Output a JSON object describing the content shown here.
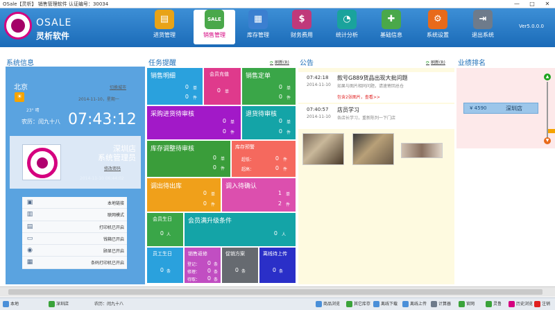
{
  "titlebar": {
    "text": "OSale【灵析】 销售管理软件 认证编号：30034",
    "min": "—",
    "max": "□",
    "close": "✕"
  },
  "brand": {
    "en": "OSALE",
    "cn": "灵析软件"
  },
  "nav": [
    {
      "label": "进货管理",
      "color": "#e8a317",
      "glyph": "▤"
    },
    {
      "label": "销售管理",
      "color": "#4aa84a",
      "glyph": "SALE"
    },
    {
      "label": "库存管理",
      "color": "#3b7fd0",
      "glyph": "▦"
    },
    {
      "label": "财务费用",
      "color": "#c0397a",
      "glyph": "$"
    },
    {
      "label": "统计分析",
      "color": "#1aa39c",
      "glyph": "◔"
    },
    {
      "label": "基础信息",
      "color": "#4aa84a",
      "glyph": "✚"
    },
    {
      "label": "系统设置",
      "color": "#e86a1a",
      "glyph": "⚙"
    },
    {
      "label": "退出系统",
      "color": "#6e7b8b",
      "glyph": "⇥"
    }
  ],
  "version": "Ver5.0.0.0",
  "sections": {
    "sysinfo": "系统信息",
    "tasks": "任务提醒",
    "notice": "公告",
    "rank": "业绩排名",
    "refresh": "刷新(R)"
  },
  "sysinfo": {
    "city": "北京",
    "temp": "23° 晴",
    "switch_city": "切换城市",
    "date": "2014-11-10，星期一",
    "lunar": "农历：闰九十八",
    "clock": "07:43:12",
    "store": "深圳店",
    "role": "系统管理员",
    "change_pwd": "修改密码",
    "login_time": "2014-11-10 06:44:02",
    "devices": [
      {
        "label": "本地链接",
        "icon": "network-icon",
        "glyph": "▣"
      },
      {
        "label": "联网模式",
        "icon": "online-icon",
        "glyph": "▥"
      },
      {
        "label": "打印机已开启",
        "icon": "printer-icon",
        "glyph": "▤"
      },
      {
        "label": "钱箱已开启",
        "icon": "cashbox-icon",
        "glyph": "▭"
      },
      {
        "label": "顾显已开启",
        "icon": "eye-icon",
        "glyph": "◉"
      },
      {
        "label": "条码打印机已开启",
        "icon": "barcode-printer-icon",
        "glyph": "▦"
      }
    ]
  },
  "tasks": {
    "sales_detail": {
      "title": "销售明细",
      "v1": "0",
      "u1": "单",
      "v2": "0",
      "u2": "件"
    },
    "member_recharge": {
      "title": "会员充值",
      "v1": "0",
      "u1": "单"
    },
    "sales_order": {
      "title": "销售定单",
      "v1": "0",
      "u1": "单",
      "v2": "0",
      "u2": "件"
    },
    "purchase_review": {
      "title": "采购进货待审核",
      "v1": "0",
      "u1": "单",
      "v2": "0",
      "u2": "件"
    },
    "return_review": {
      "title": "退货待审核",
      "v1": "0",
      "u1": "单",
      "v2": "0",
      "u2": "件"
    },
    "stock_adjust": {
      "title": "库存调整待审核",
      "v1": "0",
      "u1": "单",
      "v2": "0",
      "u2": "件"
    },
    "stock_warning": {
      "title": "库存预警",
      "l1": "超低：",
      "v1": "0",
      "u1": "件",
      "l2": "超高：",
      "v2": "0",
      "u2": "件"
    },
    "transfer_out": {
      "title": "调出待出库",
      "v1": "0",
      "u1": "单",
      "v2": "0",
      "u2": "件"
    },
    "transfer_in": {
      "title": "调入待确认",
      "v1": "1",
      "u1": "单",
      "v2": "2",
      "u2": "件"
    },
    "member_birthday": {
      "title": "会员生日",
      "v1": "0",
      "u1": "人"
    },
    "member_upgrade": {
      "title": "会员满升级条件",
      "v1": "0",
      "u1": "人"
    },
    "staff_birthday": {
      "title": "员工生日",
      "v1": "0",
      "u1": "条"
    },
    "sales_return": {
      "title": "销售返修",
      "l1": "登记：",
      "v1": "0",
      "u1": "条",
      "l2": "修理：",
      "v2": "0",
      "u2": "条",
      "l3": "待取：",
      "v3": "0",
      "u3": "条"
    },
    "promotion": {
      "title": "促销方案",
      "v1": "0",
      "u1": "条"
    },
    "offline_upload": {
      "title": "离线待上传",
      "v1": "0",
      "u1": "条"
    }
  },
  "notices": [
    {
      "time": "07:42:18",
      "date": "2014-11-10",
      "title": "款号G889货品出现大批问题",
      "sub": "如果与图片相同问题，请速寄回总仓",
      "link": "包含2张图片，查看>>"
    },
    {
      "time": "07:40:57",
      "date": "2014-11-10",
      "title": "店员学习",
      "sub": "各店长学习，重新陈列一下门店",
      "link": ""
    }
  ],
  "rank": {
    "amount": "¥ 4590",
    "store": "深圳店"
  },
  "statusbar": {
    "left": [
      {
        "label": "本地",
        "color": "#4a8fd8"
      },
      {
        "label": "深圳店",
        "color": "#3aa33a"
      },
      {
        "label": "农历：闰九十八",
        "color": ""
      }
    ],
    "right": [
      {
        "label": "商品浏览",
        "color": "#4a8fd8"
      },
      {
        "label": "其它库存",
        "color": "#3aa33a"
      },
      {
        "label": "离线下载",
        "color": "#4a8fd8"
      },
      {
        "label": "离线上传",
        "color": "#4a8fd8"
      },
      {
        "label": "计算器",
        "color": "#6e7b8b"
      },
      {
        "label": "官网",
        "color": "#3aa33a"
      },
      {
        "label": "灵鲁",
        "color": "#3aa33a"
      },
      {
        "label": "历史浏览",
        "color": "#d5007f"
      },
      {
        "label": "注销",
        "color": "#e02020"
      }
    ]
  }
}
